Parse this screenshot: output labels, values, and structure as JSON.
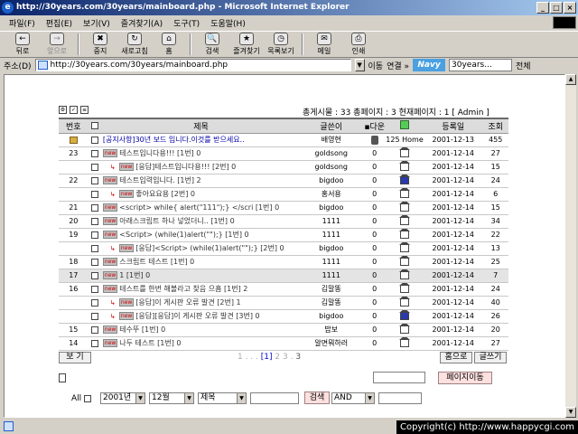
{
  "window": {
    "title": "http://30years.com/30years/mainboard.php - Microsoft Internet Explorer",
    "min": "_",
    "max": "□",
    "close": "×"
  },
  "menu": [
    "파일(F)",
    "편집(E)",
    "보기(V)",
    "즐겨찾기(A)",
    "도구(T)",
    "도움말(H)"
  ],
  "toolbar": [
    {
      "label": "뒤로",
      "icon": "←",
      "dis": false
    },
    {
      "label": "앞으로",
      "icon": "→",
      "dis": true
    },
    {
      "label": "중지",
      "icon": "✖",
      "dis": false
    },
    {
      "label": "새로고침",
      "icon": "↻",
      "dis": false
    },
    {
      "label": "홈",
      "icon": "⌂",
      "dis": false
    },
    {
      "label": "검색",
      "icon": "🔍",
      "dis": false
    },
    {
      "label": "즐겨찾기",
      "icon": "★",
      "dis": false
    },
    {
      "label": "목록보기",
      "icon": "◷",
      "dis": false
    },
    {
      "label": "메일",
      "icon": "✉",
      "dis": false
    },
    {
      "label": "인쇄",
      "icon": "⎙",
      "dis": false
    }
  ],
  "address": {
    "label": "주소(D)",
    "url": "http://30years.com/30years/mainboard.php",
    "go": "이동",
    "links": "연결 »",
    "navy": "Navy",
    "search": "30years...",
    "all": "전체"
  },
  "board": {
    "stats": "총게시물 : 33   총페이지 : 3   현재페이지 : 1 [ Admin ]",
    "headers": {
      "no": "번호",
      "title": "제목",
      "writer": "글쓴이",
      "down": "다운",
      "date": "등록일",
      "views": "조회"
    },
    "rows": [
      {
        "no": "",
        "title": "[공지사항]30년 보드 입니다.이것를 받으세요..",
        "writer": "배영현",
        "down": "125",
        "home": "Home",
        "date": "2001-12-13",
        "views": "455",
        "notice": true,
        "reply": false,
        "hl": false,
        "hb": false
      },
      {
        "no": "23",
        "title": "테스트입니다용!!! [1번] 0",
        "writer": "goldsong",
        "down": "0",
        "home": "",
        "date": "2001-12-14",
        "views": "27",
        "notice": false,
        "reply": false,
        "hl": false,
        "hb": false
      },
      {
        "no": "",
        "title": "[응답]테스트입니다용!!! [2번] 0",
        "writer": "goldsong",
        "down": "0",
        "home": "",
        "date": "2001-12-14",
        "views": "15",
        "notice": false,
        "reply": true,
        "hl": false,
        "hb": false
      },
      {
        "no": "22",
        "title": "테스트입력입니다. [1번] 2",
        "writer": "bigdoo",
        "down": "0",
        "home": "",
        "date": "2001-12-14",
        "views": "24",
        "notice": false,
        "reply": false,
        "hl": false,
        "hb": true
      },
      {
        "no": "",
        "title": "좋아요요용 [2번] 0",
        "writer": "홍서용",
        "down": "0",
        "home": "",
        "date": "2001-12-14",
        "views": "6",
        "notice": false,
        "reply": true,
        "hl": false,
        "hb": false
      },
      {
        "no": "21",
        "title": "<script> while{ alert(\"111\");} </scri [1번] 0",
        "writer": "bigdoo",
        "down": "0",
        "home": "",
        "date": "2001-12-14",
        "views": "15",
        "notice": false,
        "reply": false,
        "hl": false,
        "hb": false
      },
      {
        "no": "20",
        "title": "아래스크립트 하나 넣었더니.. [1번] 0",
        "writer": "1111",
        "down": "0",
        "home": "",
        "date": "2001-12-14",
        "views": "34",
        "notice": false,
        "reply": false,
        "hl": false,
        "hb": false
      },
      {
        "no": "19",
        "title": "<Script> (while(1)alert(\"\");} [1번] 0",
        "writer": "1111",
        "down": "0",
        "home": "",
        "date": "2001-12-14",
        "views": "22",
        "notice": false,
        "reply": false,
        "hl": false,
        "hb": false
      },
      {
        "no": "",
        "title": "[응답]<Script> (while(1)alert(\"\");} [2번] 0",
        "writer": "bigdoo",
        "down": "0",
        "home": "",
        "date": "2001-12-14",
        "views": "13",
        "notice": false,
        "reply": true,
        "hl": false,
        "hb": false
      },
      {
        "no": "18",
        "title": "스크립트 테스트 [1번] 0",
        "writer": "1111",
        "down": "0",
        "home": "",
        "date": "2001-12-14",
        "views": "25",
        "notice": false,
        "reply": false,
        "hl": false,
        "hb": false
      },
      {
        "no": "17",
        "title": "1 [1번] 0",
        "writer": "1111",
        "down": "0",
        "home": "",
        "date": "2001-12-14",
        "views": "7",
        "notice": false,
        "reply": false,
        "hl": true,
        "hb": false
      },
      {
        "no": "16",
        "title": "테스트를 한번 해볼라고 찾음 으흠 [1번] 2",
        "writer": "김말똥",
        "down": "0",
        "home": "",
        "date": "2001-12-14",
        "views": "24",
        "notice": false,
        "reply": false,
        "hl": false,
        "hb": false
      },
      {
        "no": "",
        "title": "[응답]이 게시판 오류 발견 [2번] 1",
        "writer": "김말똥",
        "down": "0",
        "home": "",
        "date": "2001-12-14",
        "views": "40",
        "notice": false,
        "reply": true,
        "hl": false,
        "hb": false
      },
      {
        "no": "",
        "title": "[응답][응답]이 게시판 오류 발견 [3번] 0",
        "writer": "bigdoo",
        "down": "0",
        "home": "",
        "date": "2001-12-14",
        "views": "26",
        "notice": false,
        "reply": true,
        "hl": false,
        "hb": true
      },
      {
        "no": "15",
        "title": "테수뚜 [1번] 0",
        "writer": "밥보",
        "down": "0",
        "home": "",
        "date": "2001-12-14",
        "views": "20",
        "notice": false,
        "reply": false,
        "hl": false,
        "hb": false
      },
      {
        "no": "14",
        "title": "나두 테스트 [1번] 0",
        "writer": "알면뭐하러",
        "down": "0",
        "home": "",
        "date": "2001-12-14",
        "views": "27",
        "notice": false,
        "reply": false,
        "hl": false,
        "hb": false
      }
    ],
    "view_btn": "보 기",
    "pages": {
      "prev": "1 . . .",
      "cur": "[1]",
      "others": "2 3 .",
      "next": "3"
    },
    "home_btn": "홈으로",
    "write_btn": "글쓰기",
    "page_move": "페이지이동",
    "search": {
      "all_label": "All",
      "year": "2001년",
      "month": "12월",
      "field": "제목",
      "button": "검색",
      "op": "AND"
    }
  },
  "copyright": "Copyright(c) http://www.happycgi.com"
}
